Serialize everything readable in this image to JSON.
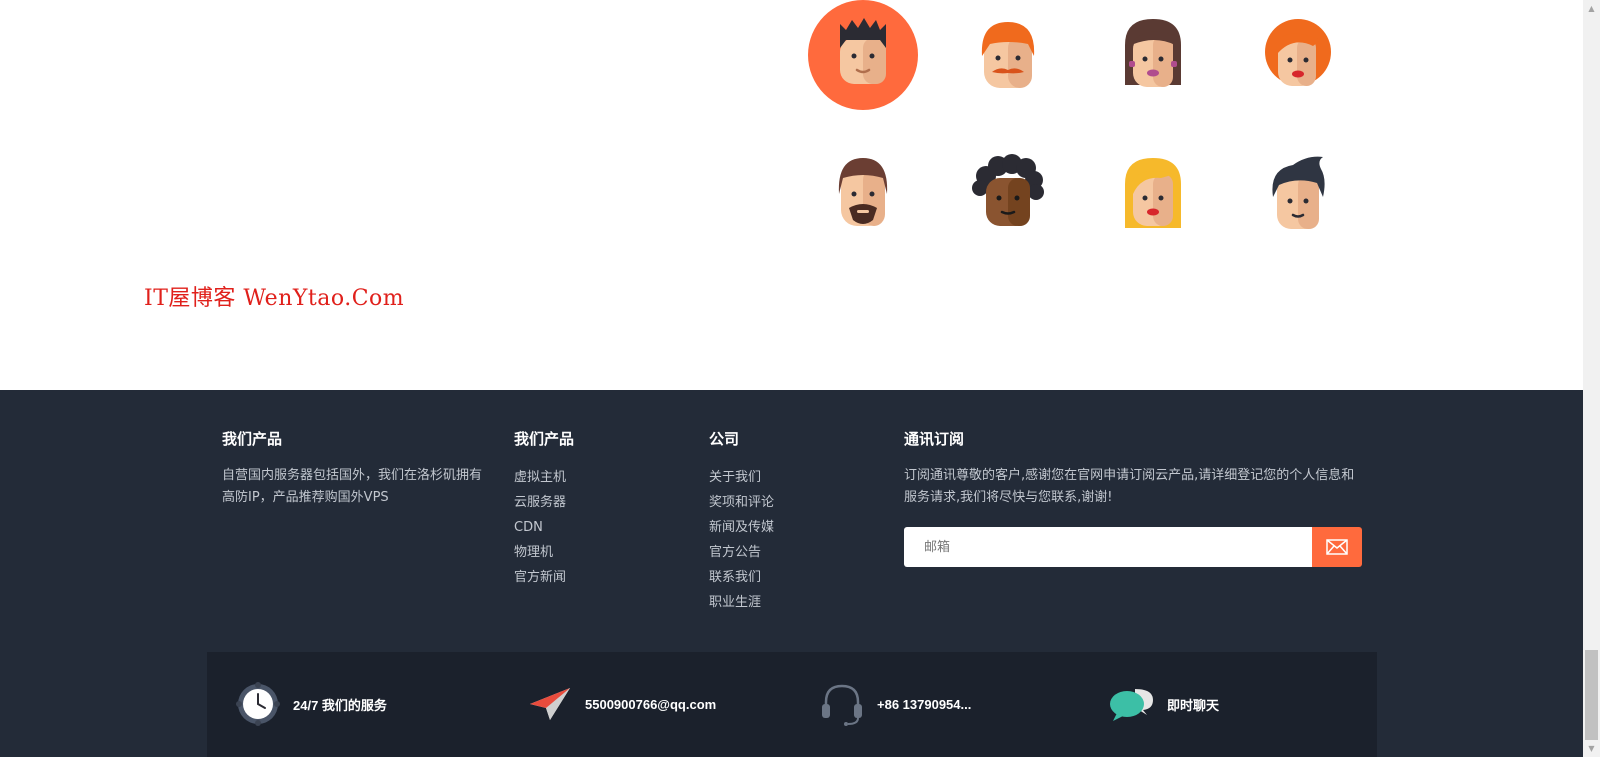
{
  "watermark": "IT屋博客 WenYtao.Com",
  "avatars": [
    "avatar-spiky-hair-man",
    "avatar-red-hair-mustache",
    "avatar-brown-hair-woman",
    "avatar-red-hair-woman",
    "avatar-bearded-man",
    "avatar-curly-hair-man",
    "avatar-blonde-woman",
    "avatar-quiff-man"
  ],
  "footer": {
    "col1": {
      "title": "我们产品",
      "text": "自营国内服务器包括国外，我们在洛杉矶拥有高防IP，产品推荐购国外VPS"
    },
    "col2": {
      "title": "我们产品",
      "items": [
        "虚拟主机",
        "云服务器",
        "CDN",
        "物理机",
        "官方新闻"
      ]
    },
    "col3": {
      "title": "公司",
      "items": [
        "关于我们",
        "奖项和评论",
        "新闻及传媒",
        "官方公告",
        "联系我们",
        "职业生涯"
      ]
    },
    "col4": {
      "title": "通讯订阅",
      "text": "订阅通讯尊敬的客户,感谢您在官网申请订阅云产品,请详细登记您的个人信息和服务请求,我们将尽快与您联系,谢谢!",
      "placeholder": "邮箱"
    }
  },
  "features": [
    {
      "icon": "clock-icon",
      "text": "24/7 我们的服务"
    },
    {
      "icon": "paper-plane-icon",
      "text": "5500900766@qq.com"
    },
    {
      "icon": "headset-icon",
      "text": "+86 13790954..."
    },
    {
      "icon": "chat-bubbles-icon",
      "text": "即时聊天"
    }
  ],
  "colors": {
    "footer_bg": "#232b38",
    "bar_bg": "#1b212c",
    "accent": "#ff6a3d",
    "watermark": "#e0201b"
  }
}
